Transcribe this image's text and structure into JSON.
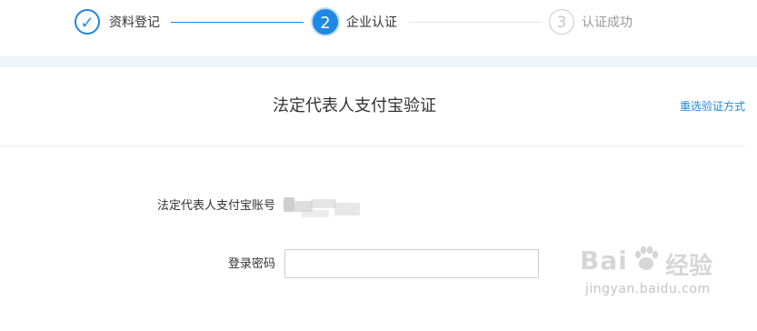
{
  "stepper": {
    "steps": [
      {
        "number": "✓",
        "label": "资料登记",
        "state": "done"
      },
      {
        "number": "2",
        "label": "企业认证",
        "state": "active"
      },
      {
        "number": "3",
        "label": "认证成功",
        "state": "pending"
      }
    ]
  },
  "card": {
    "title": "法定代表人支付宝验证",
    "reselect_link": "重选验证方式"
  },
  "form": {
    "account_label": "法定代表人支付宝账号",
    "password_label": "登录密码",
    "password_value": "",
    "password_placeholder": ""
  },
  "watermark": {
    "brand": "Bai",
    "brand_suffix": "经验",
    "url": "jingyan.baidu.com"
  },
  "colors": {
    "accent": "#1e88e5",
    "band": "#eef5fb",
    "pending": "#c8c8c8"
  }
}
